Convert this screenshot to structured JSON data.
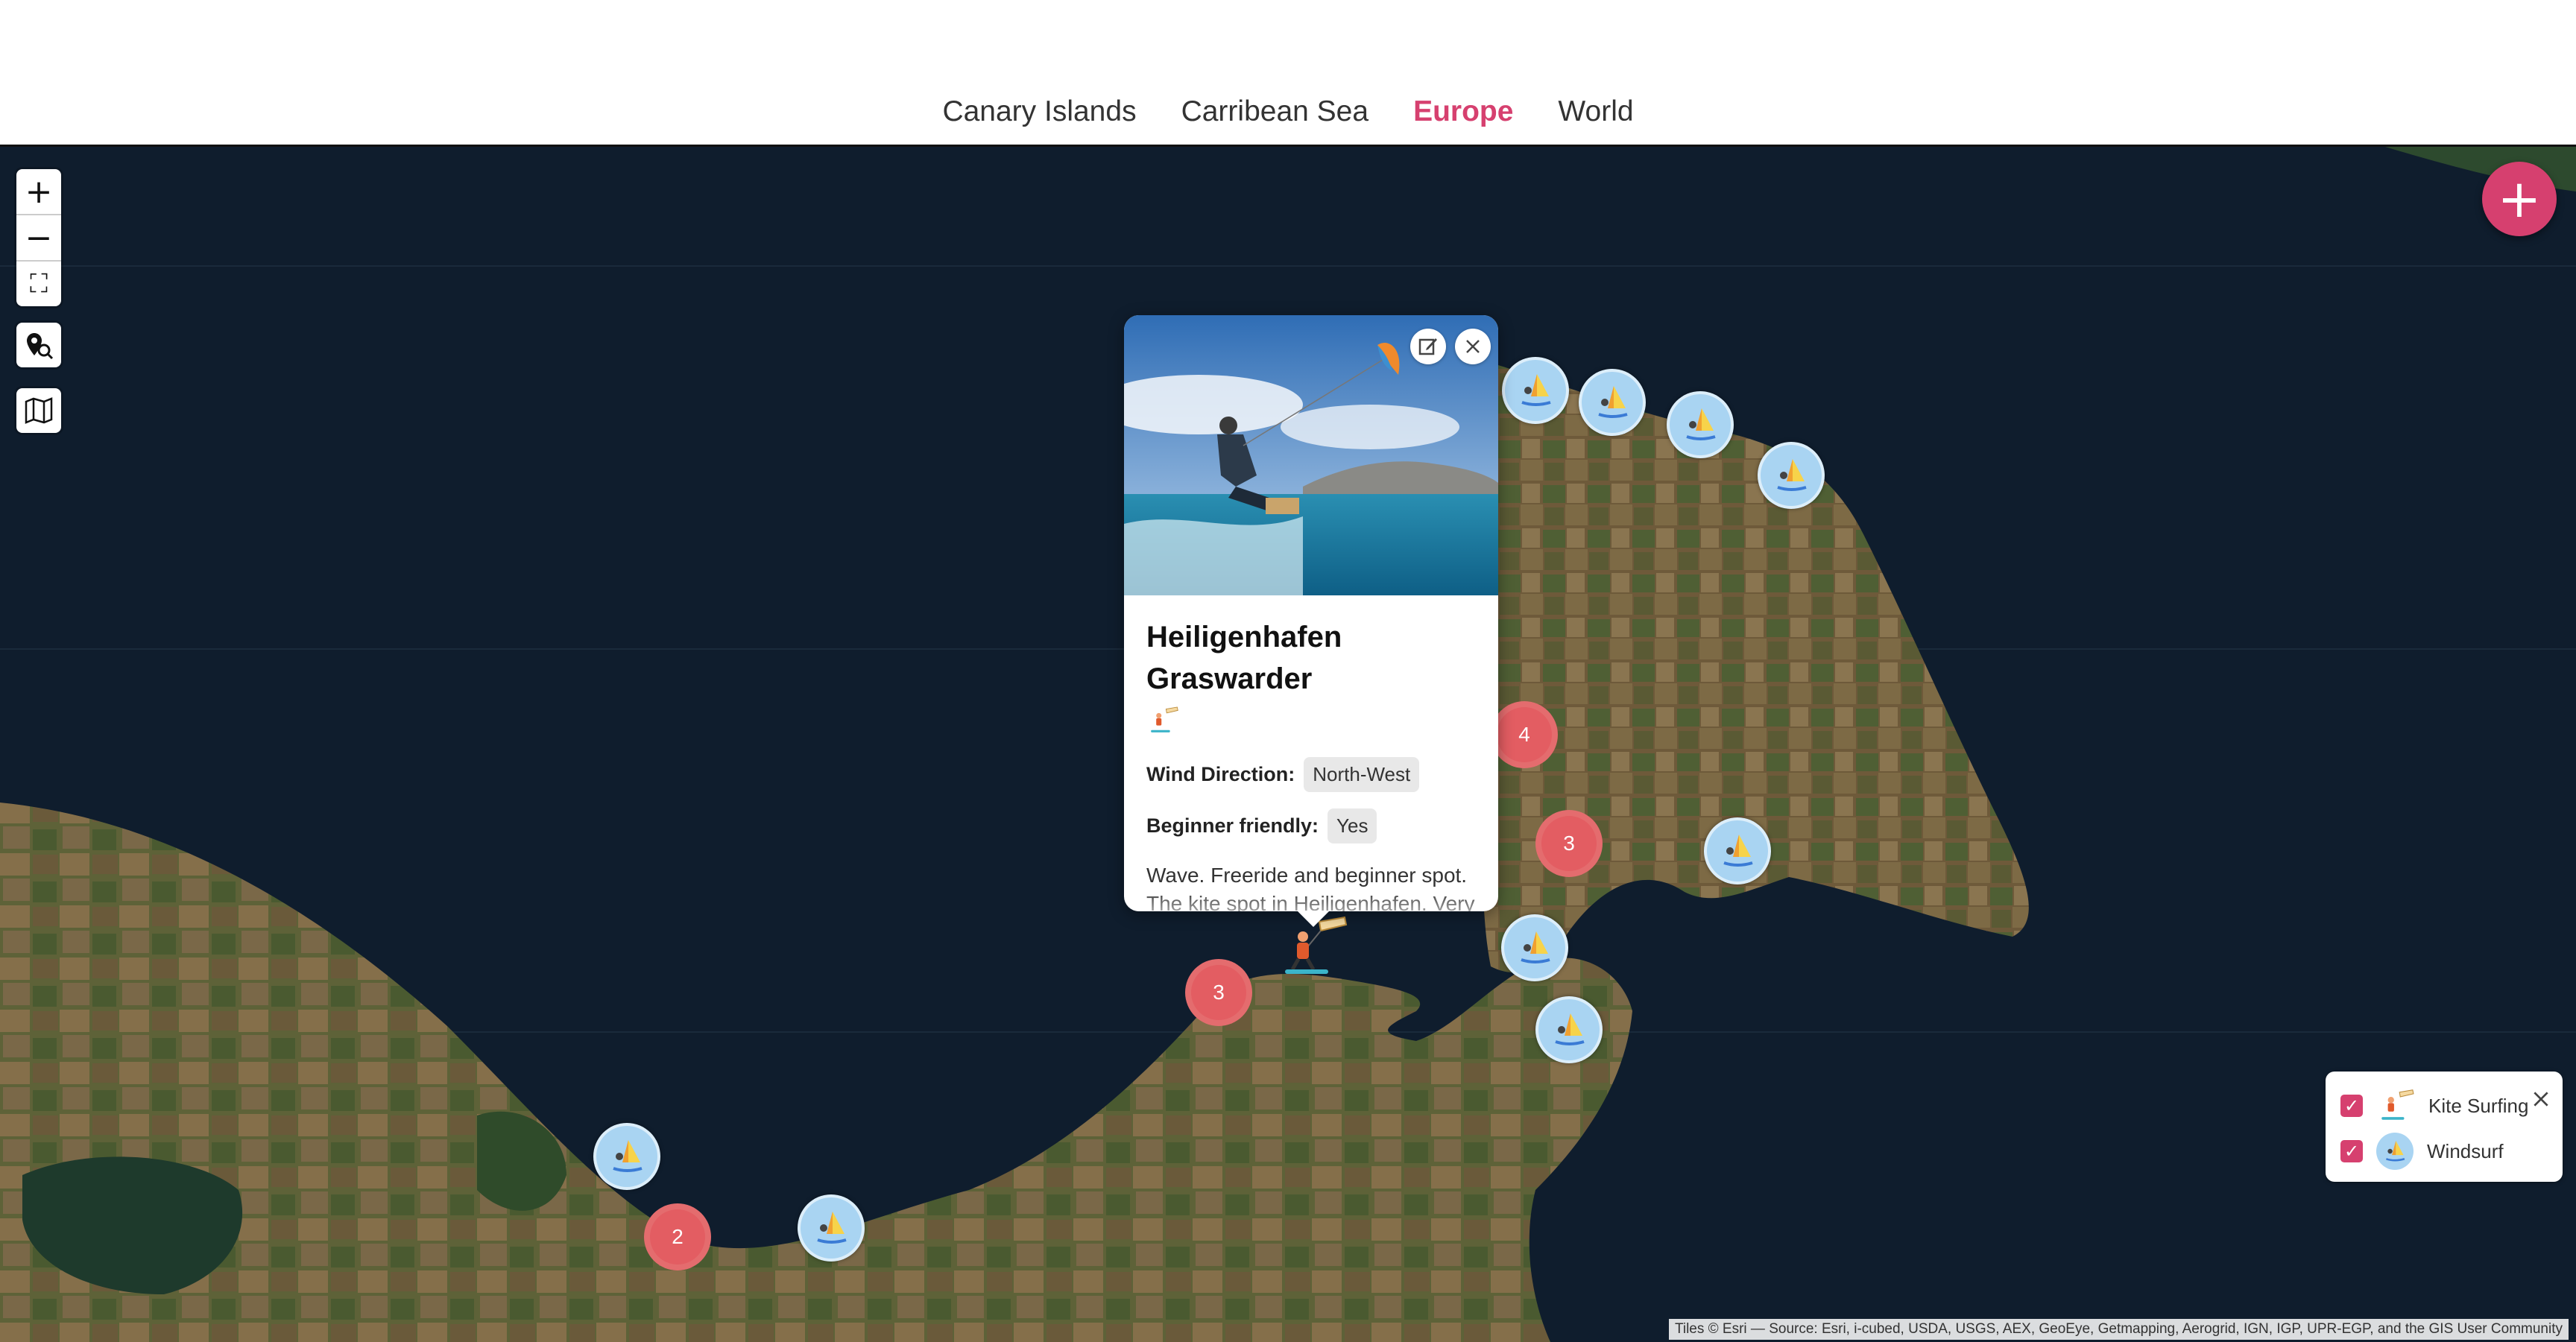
{
  "tabs": [
    {
      "label": "Canary Islands"
    },
    {
      "label": "Carribean Sea"
    },
    {
      "label": "Europe",
      "active": true
    },
    {
      "label": "World"
    }
  ],
  "controls": {
    "zoom_in": "+",
    "zoom_out": "−",
    "fullscreen": "⛶",
    "add_button": "+"
  },
  "popup": {
    "title": "Heiligenhafen Graswarder",
    "wind_direction_label": "Wind Direction:",
    "wind_direction_value": "North-West",
    "beginner_label": "Beginner friendly:",
    "beginner_value": "Yes",
    "description": "Wave. Freeride and beginner spot. The kite spot in Heiligenhafen. Very"
  },
  "clusters": [
    {
      "count": "4"
    },
    {
      "count": "3"
    },
    {
      "count": "3"
    },
    {
      "count": "2"
    }
  ],
  "legend": {
    "items": [
      {
        "label": "Kite Surfing",
        "checked": true,
        "icon": "kite-surfer-icon"
      },
      {
        "label": "Windsurf",
        "checked": true,
        "icon": "windsurf-icon"
      }
    ]
  },
  "attribution": "Tiles © Esri — Source: Esri, i-cubed, USDA, USGS, AEX, GeoEye, Getmapping, Aerogrid, IGN, IGP, UPR-EGP, and the GIS User Community",
  "colors": {
    "accent": "#d6406f",
    "sea": "#0f1d2d",
    "land": "#6b5a3c",
    "windsurf_marker": "#a9d4f2",
    "cluster": "#e35d62"
  }
}
